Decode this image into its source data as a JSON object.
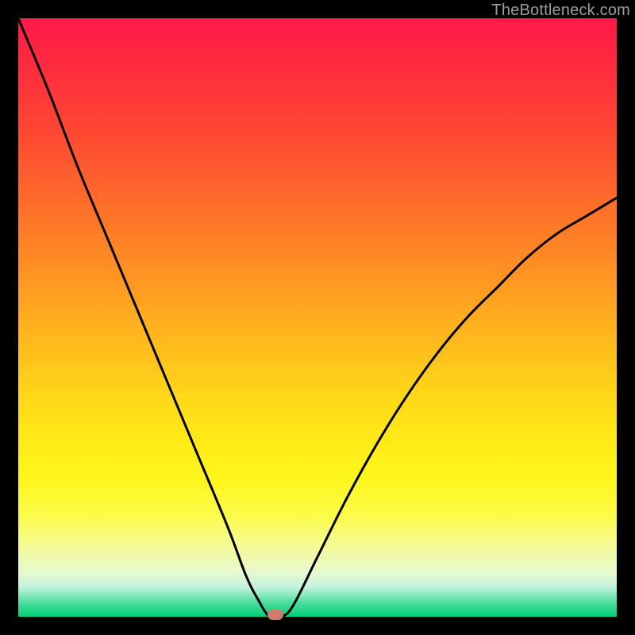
{
  "watermark": "TheBottleneck.com",
  "colors": {
    "frame": "#000000",
    "curve": "#000000",
    "marker": "#cf7b6e"
  },
  "chart_data": {
    "type": "line",
    "title": "",
    "xlabel": "",
    "ylabel": "",
    "xlim": [
      0,
      100
    ],
    "ylim": [
      0,
      100
    ],
    "grid": false,
    "background_gradient": {
      "top": "#ff1848",
      "mid": "#ffe918",
      "bottom": "#00cf7a",
      "meaning": "red=high bottleneck, green=low bottleneck"
    },
    "series": [
      {
        "name": "bottleneck-curve",
        "x": [
          0,
          5,
          10,
          15,
          20,
          25,
          30,
          35,
          38,
          40,
          42,
          44,
          46,
          50,
          55,
          60,
          65,
          70,
          75,
          80,
          85,
          90,
          95,
          100
        ],
        "values": [
          100,
          88,
          75,
          63,
          51,
          39,
          27,
          15,
          7,
          3,
          0,
          0,
          2,
          10,
          20,
          29,
          37,
          44,
          50,
          55,
          60,
          64,
          67,
          70
        ]
      }
    ],
    "annotations": [
      {
        "name": "optimal-point",
        "x": 43,
        "y": 0
      }
    ]
  }
}
